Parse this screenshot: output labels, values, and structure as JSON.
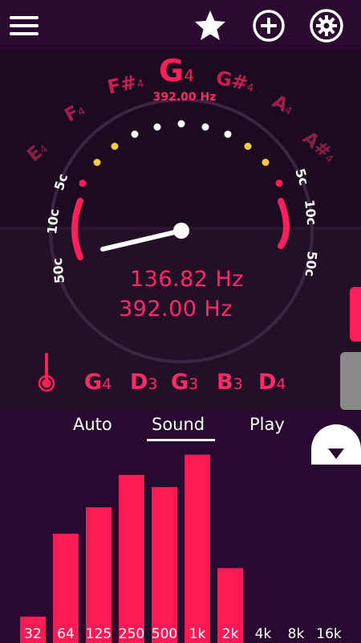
{
  "topbar": {
    "menu_icon": "menu-icon",
    "favorite_icon": "star-icon",
    "add_icon": "plus-circle-icon",
    "settings_icon": "gear-icon"
  },
  "tuner": {
    "notes": [
      {
        "name": "E",
        "octave": "4"
      },
      {
        "name": "F",
        "octave": "4"
      },
      {
        "name": "F#",
        "octave": "4"
      },
      {
        "name": "G",
        "octave": "4"
      },
      {
        "name": "G#",
        "octave": "4"
      },
      {
        "name": "A",
        "octave": "4"
      },
      {
        "name": "A#",
        "octave": "4"
      }
    ],
    "center_note": {
      "name": "G",
      "octave": "4"
    },
    "reference_hz": "392.00 Hz",
    "cents_left": [
      "5c",
      "10c",
      "50c"
    ],
    "cents_right": [
      "5c",
      "10c",
      "50c"
    ],
    "current_frequency": "136.82 Hz",
    "target_frequency": "392.00 Hz",
    "strings": [
      {
        "name": "G",
        "octave": "4"
      },
      {
        "name": "D",
        "octave": "3"
      },
      {
        "name": "G",
        "octave": "3"
      },
      {
        "name": "B",
        "octave": "3"
      },
      {
        "name": "D",
        "octave": "4"
      }
    ],
    "accent_color": "#ff1f5a"
  },
  "modes": {
    "tabs": [
      "Auto",
      "Sound",
      "Play"
    ],
    "active": "Sound"
  },
  "collapse_icon": "triangle-down-icon",
  "chart_data": {
    "type": "bar",
    "categories": [
      "32",
      "64",
      "125",
      "250",
      "500",
      "1k",
      "2k",
      "4k",
      "8k",
      "16k"
    ],
    "values": [
      0.13,
      0.54,
      0.67,
      0.83,
      0.77,
      0.93,
      0.37,
      0,
      0,
      0
    ],
    "ylim": [
      0,
      1
    ]
  }
}
